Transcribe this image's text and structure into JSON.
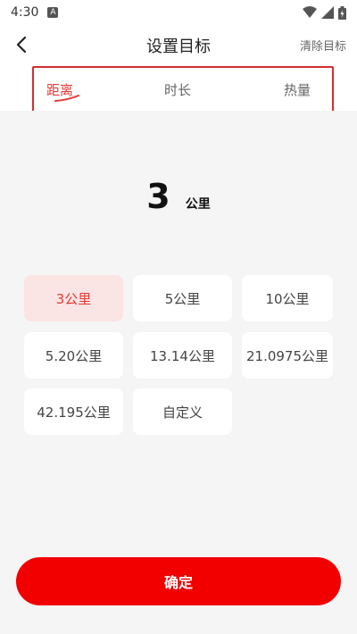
{
  "status_bar": {
    "time": "4:30",
    "notification_letter": "A"
  },
  "header": {
    "title": "设置目标",
    "clear_label": "清除目标"
  },
  "tabs": [
    {
      "label": "距离",
      "active": true
    },
    {
      "label": "时长",
      "active": false
    },
    {
      "label": "热量",
      "active": false
    }
  ],
  "current_goal": {
    "value": "3",
    "unit": "公里"
  },
  "options": [
    {
      "label": "3公里",
      "selected": true
    },
    {
      "label": "5公里",
      "selected": false
    },
    {
      "label": "10公里",
      "selected": false
    },
    {
      "label": "5.20公里",
      "selected": false
    },
    {
      "label": "13.14公里",
      "selected": false
    },
    {
      "label": "21.0975公里",
      "selected": false
    },
    {
      "label": "42.195公里",
      "selected": false
    },
    {
      "label": "自定义",
      "selected": false
    }
  ],
  "confirm_label": "确定",
  "colors": {
    "accent": "#e53935",
    "confirm_bg": "#f20000",
    "selected_bg": "#fbe4e4",
    "content_bg": "#f5f5f5"
  }
}
